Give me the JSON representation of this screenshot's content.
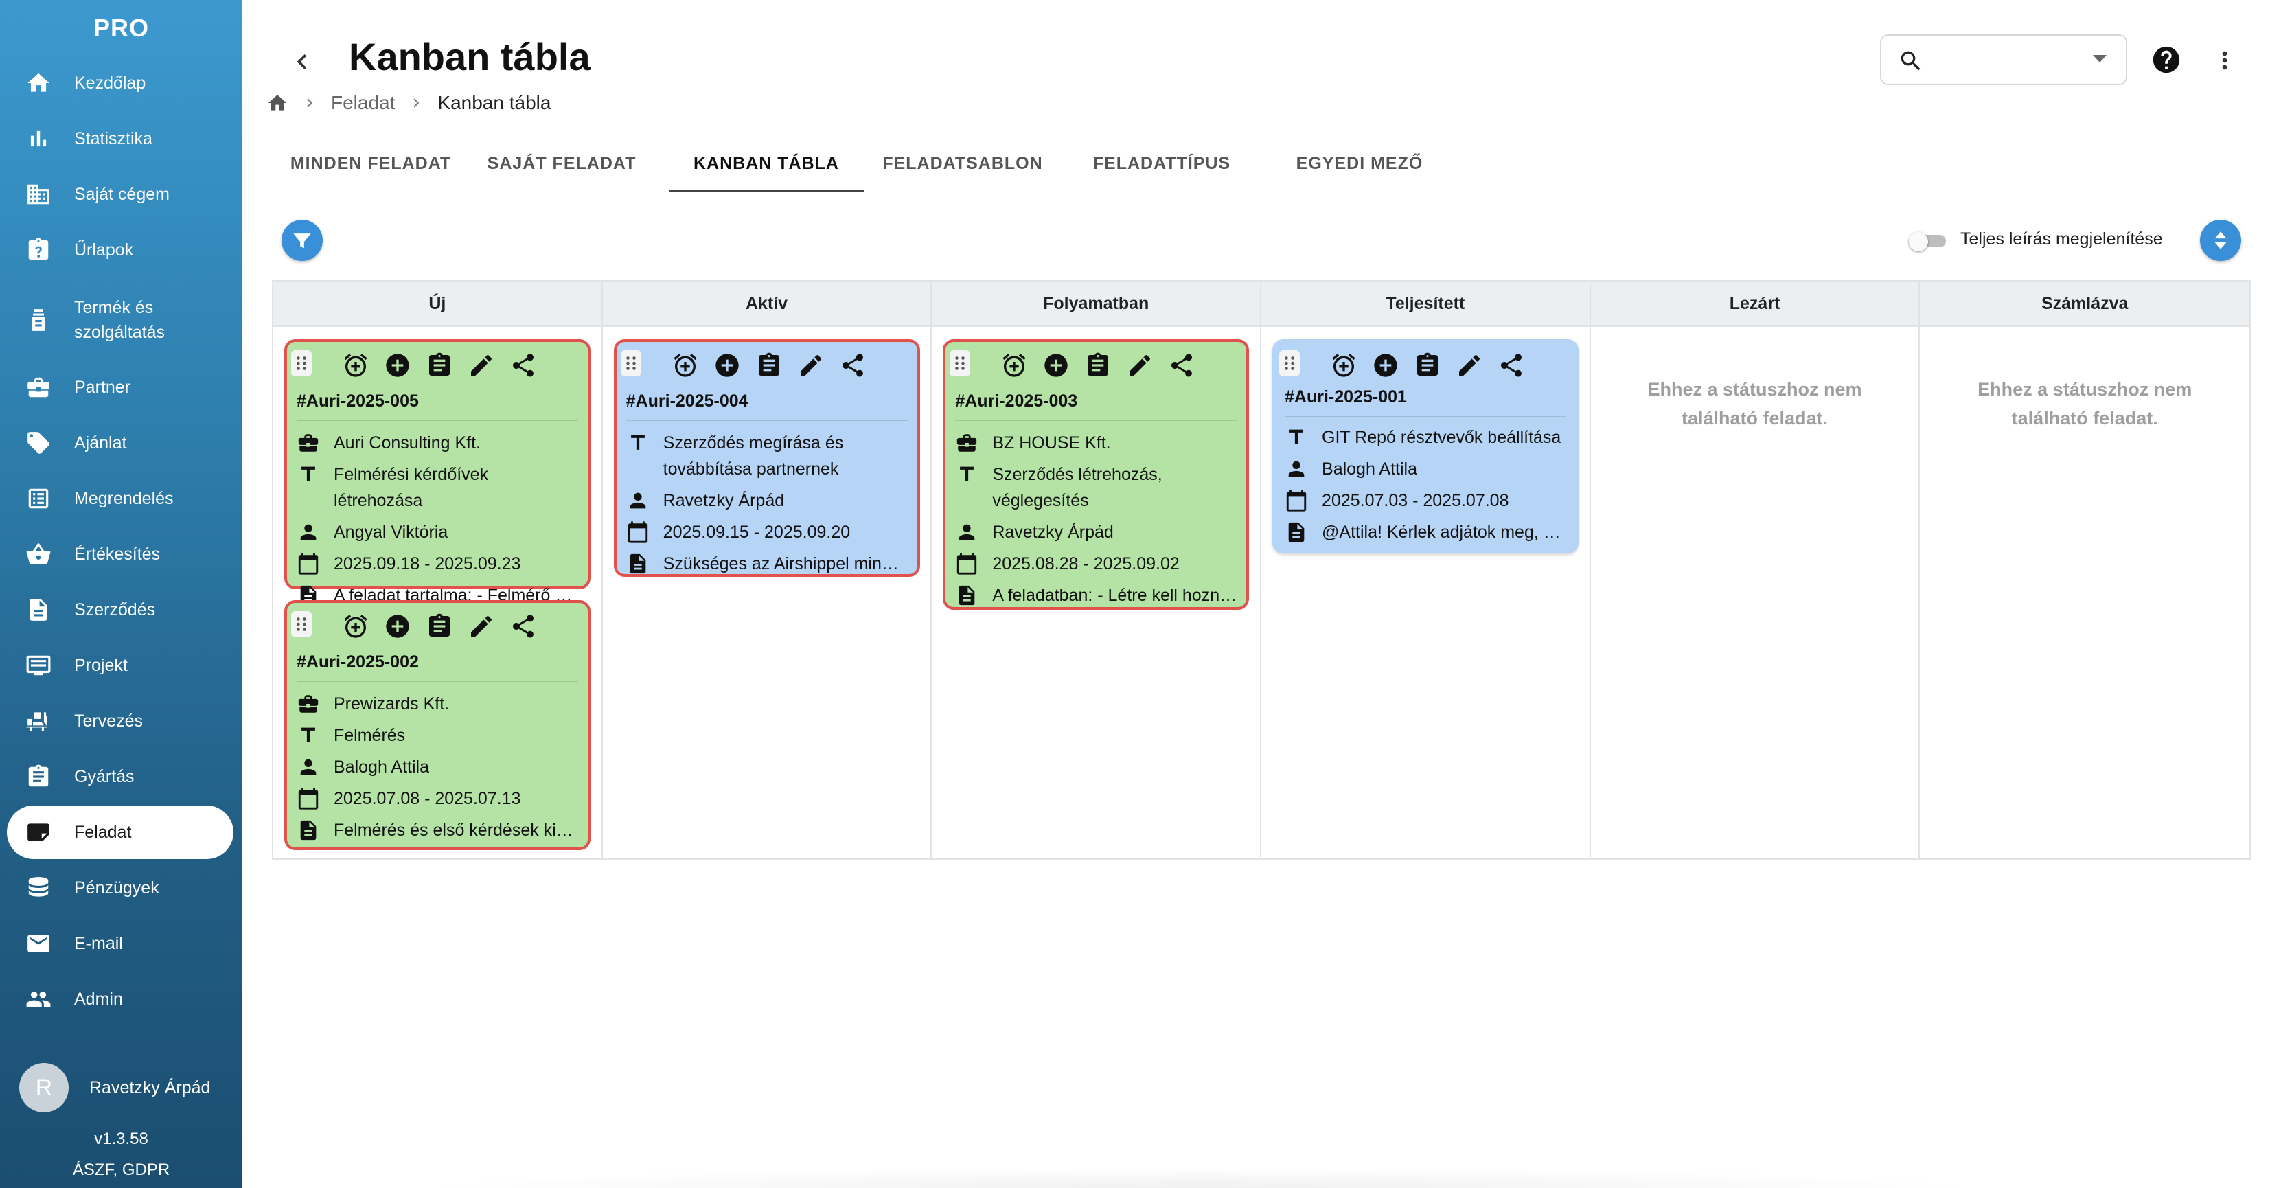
{
  "sidebar": {
    "brand": "PRO",
    "items": [
      {
        "label": "Kezdőlap",
        "icon": "home-icon"
      },
      {
        "label": "Statisztika",
        "icon": "bar-chart-icon"
      },
      {
        "label": "Saját cégem",
        "icon": "building-icon"
      },
      {
        "label": "Űrlapok",
        "icon": "clipboard-question-icon"
      },
      {
        "label": "Termék és szolgáltatás",
        "icon": "product-icon"
      },
      {
        "label": "Partner",
        "icon": "briefcase-icon"
      },
      {
        "label": "Ajánlat",
        "icon": "tag-icon"
      },
      {
        "label": "Megrendelés",
        "icon": "order-list-icon"
      },
      {
        "label": "Értékesítés",
        "icon": "shopping-basket-icon"
      },
      {
        "label": "Szerződés",
        "icon": "document-icon"
      },
      {
        "label": "Projekt",
        "icon": "project-icon"
      },
      {
        "label": "Tervezés",
        "icon": "planning-icon"
      },
      {
        "label": "Gyártás",
        "icon": "clipboard-list-icon"
      },
      {
        "label": "Feladat",
        "icon": "task-icon"
      },
      {
        "label": "Pénzügyek",
        "icon": "coins-icon"
      },
      {
        "label": "E-mail",
        "icon": "mail-icon"
      },
      {
        "label": "Admin",
        "icon": "users-icon"
      }
    ],
    "user": {
      "initial": "R",
      "name": "Ravetzky Árpád"
    },
    "version": "v1.3.58",
    "legal": "ÁSZF, GDPR"
  },
  "header": {
    "title": "Kanban tábla",
    "breadcrumb": {
      "parent": "Feladat",
      "current": "Kanban tábla"
    },
    "search": {
      "value": "",
      "placeholder": ""
    }
  },
  "tabs": [
    {
      "label": "MINDEN FELADAT",
      "active": false
    },
    {
      "label": "SAJÁT FELADAT",
      "active": false
    },
    {
      "label": "KANBAN TÁBLA",
      "active": true
    },
    {
      "label": "FELADATSABLON",
      "active": false
    },
    {
      "label": "FELADATTÍPUS",
      "active": false
    },
    {
      "label": "EGYEDI MEZŐ",
      "active": false
    }
  ],
  "toolbar": {
    "toggle_label": "Teljes leírás megjelenítése",
    "toggle_on": false
  },
  "colors": {
    "accent": "#3a8fd9",
    "card_green": "#b5e3a6",
    "card_blue": "#b6d4f6",
    "overdue_border": "#e0524b"
  },
  "board": {
    "empty_text": "Ehhez a státuszhoz nem található feladat.",
    "columns": [
      {
        "title": "Új",
        "cards": [
          {
            "code": "#Auri-2025-005",
            "partner": "Auri Consulting Kft.",
            "title": "Felmérési kérdőívek létrehozása",
            "assignee": "Angyal Viktória",
            "dates": "2025.09.18 - 2025.09.23",
            "description": "A feladat tartalma: - Felmérő kérdőívek"
          },
          {
            "code": "#Auri-2025-002",
            "partner": "Prewizards Kft.",
            "title": "Felmérés",
            "assignee": "Balogh Attila",
            "dates": "2025.07.08 - 2025.07.13",
            "description": "Felmérés és első kérdések kiküldése"
          }
        ]
      },
      {
        "title": "Aktív",
        "cards": [
          {
            "code": "#Auri-2025-004",
            "title": "Szerződés megírása és továbbítása partnernek",
            "assignee": "Ravetzky Árpád",
            "dates": "2025.09.15 - 2025.09.20",
            "description": "Szükséges az Airshippel minden"
          }
        ]
      },
      {
        "title": "Folyamatban",
        "cards": [
          {
            "code": "#Auri-2025-003",
            "partner": "BZ HOUSE Kft.",
            "title": "Szerződés létrehozás, véglegesítés",
            "assignee": "Ravetzky Árpád",
            "dates": "2025.08.28 - 2025.09.02",
            "description": "A feladatban: - Létre kell hozni a"
          }
        ]
      },
      {
        "title": "Teljesített",
        "cards": [
          {
            "code": "#Auri-2025-001",
            "title": "GIT Repó résztvevők beállítása",
            "assignee": "Balogh Attila",
            "dates": "2025.07.03 - 2025.07.08",
            "description": "@Attila! Kérlek adjátok meg, hogy"
          }
        ]
      },
      {
        "title": "Lezárt",
        "cards": []
      },
      {
        "title": "Számlázva",
        "cards": []
      }
    ]
  }
}
